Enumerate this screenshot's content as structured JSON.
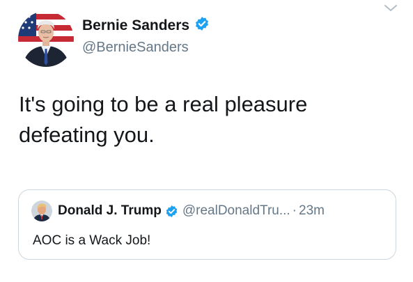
{
  "tweet": {
    "author": {
      "name": "Bernie Sanders",
      "handle": "@BernieSanders",
      "verified": true,
      "avatar_icon": "bernie-sanders-avatar"
    },
    "text": "It's going to be a real pleasure defeating you.",
    "menu_icon": "chevron-down-icon"
  },
  "quoted_tweet": {
    "author": {
      "name": "Donald J. Trump",
      "handle": "@realDonaldTru...",
      "verified": true,
      "avatar_icon": "donald-trump-avatar"
    },
    "separator": "·",
    "time": "23m",
    "text": "AOC is a Wack Job!"
  },
  "colors": {
    "text": "#14171a",
    "secondary": "#657786",
    "verified": "#1da1f2",
    "border": "#ccd6dd"
  }
}
